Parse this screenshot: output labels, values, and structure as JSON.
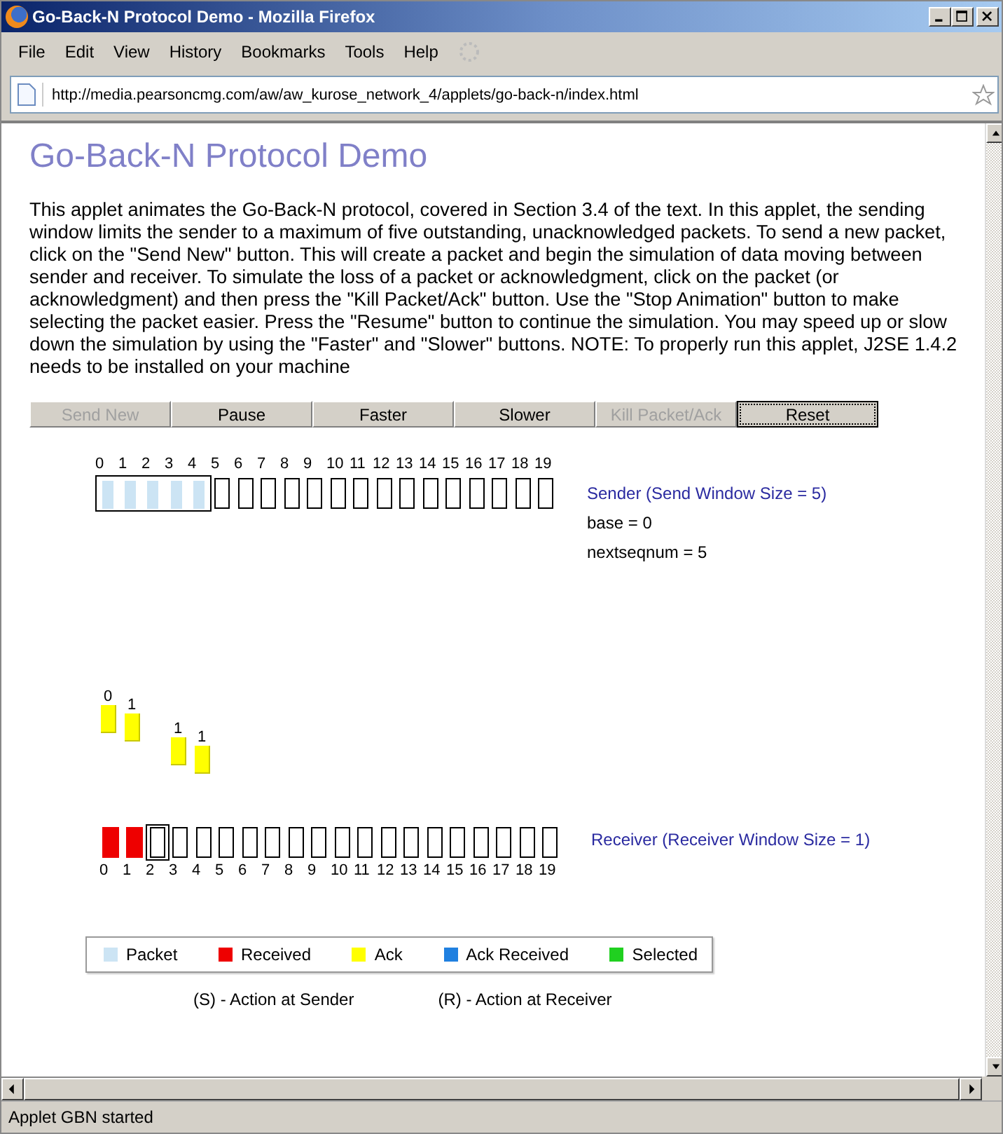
{
  "window": {
    "title": "Go-Back-N Protocol Demo - Mozilla Firefox"
  },
  "menu": [
    "File",
    "Edit",
    "View",
    "History",
    "Bookmarks",
    "Tools",
    "Help"
  ],
  "address": {
    "value": "http://media.pearsoncmg.com/aw/aw_kurose_network_4/applets/go-back-n/index.html"
  },
  "page": {
    "heading": "Go-Back-N Protocol Demo",
    "description": "This applet animates the Go-Back-N protocol, covered in Section 3.4 of the text. In this applet, the sending window limits the sender to a maximum of five outstanding, unacknowledged packets. To send a new packet, click on the \"Send New\" button. This will create a packet and begin the simulation of data moving between sender and receiver. To simulate the loss of a packet or acknowledgment, click on the packet (or acknowledgment) and then press the \"Kill Packet/Ack\" button. Use the \"Stop Animation\" button to make selecting the packet easier. Press the \"Resume\" button to continue the simulation. You may speed up or slow down the simulation by using the \"Faster\" and \"Slower\" buttons. NOTE: To properly run this applet, J2SE 1.4.2 needs to be installed on your machine"
  },
  "buttons": [
    {
      "label": "Send New",
      "disabled": true,
      "focused": false
    },
    {
      "label": "Pause",
      "disabled": false,
      "focused": false
    },
    {
      "label": "Faster",
      "disabled": false,
      "focused": false
    },
    {
      "label": "Slower",
      "disabled": false,
      "focused": false
    },
    {
      "label": "Kill Packet/Ack",
      "disabled": true,
      "focused": false
    },
    {
      "label": "Reset",
      "disabled": false,
      "focused": true
    }
  ],
  "sender": {
    "label": "Sender (Send Window Size = 5)",
    "base": "base = 0",
    "nextseqnum": "nextseqnum = 5",
    "slots": [
      {
        "number": "0",
        "kind": "packet",
        "in_window": true
      },
      {
        "number": "1",
        "kind": "packet",
        "in_window": true
      },
      {
        "number": "2",
        "kind": "packet",
        "in_window": true
      },
      {
        "number": "3",
        "kind": "packet",
        "in_window": true
      },
      {
        "number": "4",
        "kind": "packet",
        "in_window": true
      },
      {
        "number": "5",
        "kind": "empty",
        "in_window": false
      },
      {
        "number": "6",
        "kind": "empty",
        "in_window": false
      },
      {
        "number": "7",
        "kind": "empty",
        "in_window": false
      },
      {
        "number": "8",
        "kind": "empty",
        "in_window": false
      },
      {
        "number": "9",
        "kind": "empty",
        "in_window": false
      },
      {
        "number": "10",
        "kind": "empty",
        "in_window": false
      },
      {
        "number": "11",
        "kind": "empty",
        "in_window": false
      },
      {
        "number": "12",
        "kind": "empty",
        "in_window": false
      },
      {
        "number": "13",
        "kind": "empty",
        "in_window": false
      },
      {
        "number": "14",
        "kind": "empty",
        "in_window": false
      },
      {
        "number": "15",
        "kind": "empty",
        "in_window": false
      },
      {
        "number": "16",
        "kind": "empty",
        "in_window": false
      },
      {
        "number": "17",
        "kind": "empty",
        "in_window": false
      },
      {
        "number": "18",
        "kind": "empty",
        "in_window": false
      },
      {
        "number": "19",
        "kind": "empty",
        "in_window": false
      }
    ]
  },
  "in_flight": [
    {
      "kind": "ack",
      "label": "0"
    },
    {
      "kind": "ack",
      "label": "1"
    },
    {
      "kind": "ack",
      "label": "1"
    },
    {
      "kind": "ack",
      "label": "1"
    }
  ],
  "receiver": {
    "label": "Receiver (Receiver Window Size = 1)",
    "slots": [
      {
        "number": "0",
        "kind": "received",
        "in_window": false
      },
      {
        "number": "1",
        "kind": "received",
        "in_window": false
      },
      {
        "number": "2",
        "kind": "empty",
        "in_window": true
      },
      {
        "number": "3",
        "kind": "empty",
        "in_window": false
      },
      {
        "number": "4",
        "kind": "empty",
        "in_window": false
      },
      {
        "number": "5",
        "kind": "empty",
        "in_window": false
      },
      {
        "number": "6",
        "kind": "empty",
        "in_window": false
      },
      {
        "number": "7",
        "kind": "empty",
        "in_window": false
      },
      {
        "number": "8",
        "kind": "empty",
        "in_window": false
      },
      {
        "number": "9",
        "kind": "empty",
        "in_window": false
      },
      {
        "number": "10",
        "kind": "empty",
        "in_window": false
      },
      {
        "number": "11",
        "kind": "empty",
        "in_window": false
      },
      {
        "number": "12",
        "kind": "empty",
        "in_window": false
      },
      {
        "number": "13",
        "kind": "empty",
        "in_window": false
      },
      {
        "number": "14",
        "kind": "empty",
        "in_window": false
      },
      {
        "number": "15",
        "kind": "empty",
        "in_window": false
      },
      {
        "number": "16",
        "kind": "empty",
        "in_window": false
      },
      {
        "number": "17",
        "kind": "empty",
        "in_window": false
      },
      {
        "number": "18",
        "kind": "empty",
        "in_window": false
      },
      {
        "number": "19",
        "kind": "empty",
        "in_window": false
      }
    ]
  },
  "legend": [
    {
      "label": "Packet",
      "color": "#cce4f4"
    },
    {
      "label": "Received",
      "color": "#ee0000"
    },
    {
      "label": "Ack",
      "color": "#ffff00"
    },
    {
      "label": "Ack Received",
      "color": "#2080e0"
    },
    {
      "label": "Selected",
      "color": "#20d020"
    }
  ],
  "notes": [
    "(S) - Action at Sender",
    "(R) - Action at Receiver"
  ],
  "status_bar": "Applet GBN started"
}
